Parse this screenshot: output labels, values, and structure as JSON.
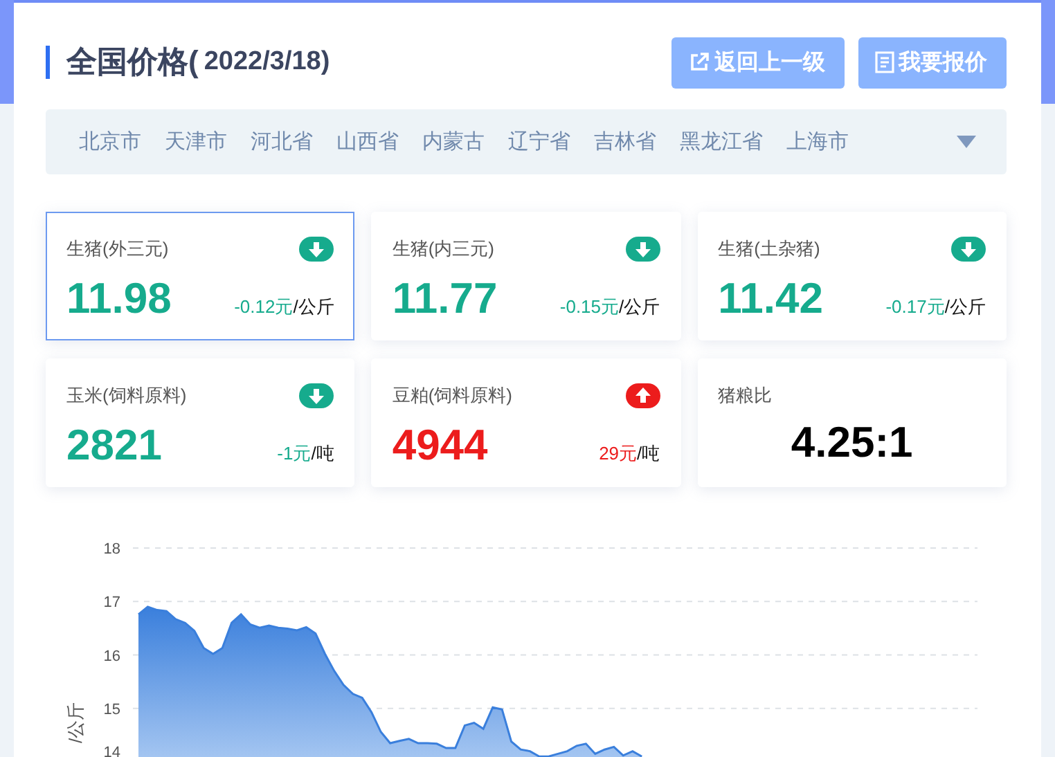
{
  "header": {
    "title": "全国价格(",
    "date": "2022/3/18)",
    "buttons": [
      {
        "kind": "back",
        "label": "返回上一级"
      },
      {
        "kind": "quote",
        "label": "我要报价"
      }
    ]
  },
  "regions": [
    "北京市",
    "天津市",
    "河北省",
    "山西省",
    "内蒙古",
    "辽宁省",
    "吉林省",
    "黑龙江省",
    "上海市"
  ],
  "cards": [
    {
      "kind": "change",
      "label": "生猪(外三元)",
      "value": "11.98",
      "change": "-0.12元",
      "unit": "/公斤",
      "rising": false,
      "selected": true
    },
    {
      "kind": "change",
      "label": "生猪(内三元)",
      "value": "11.77",
      "change": "-0.15元",
      "unit": "/公斤",
      "rising": false,
      "selected": false
    },
    {
      "kind": "change",
      "label": "生猪(土杂猪)",
      "value": "11.42",
      "change": "-0.17元",
      "unit": "/公斤",
      "rising": false,
      "selected": false
    },
    {
      "kind": "change",
      "label": "玉米(饲料原料)",
      "value": "2821",
      "change": "-1元",
      "unit": "/吨",
      "rising": false,
      "selected": false
    },
    {
      "kind": "change",
      "label": "豆粕(饲料原料)",
      "value": "4944",
      "change": "29元",
      "unit": "/吨",
      "rising": true,
      "selected": false
    },
    {
      "kind": "ratio",
      "label": "猪粮比",
      "value": "4.25:1",
      "selected": false
    }
  ],
  "chart_data": {
    "type": "area",
    "ylabel": "/公斤",
    "grid": true,
    "ylim": [
      14,
      18
    ],
    "yticks": [
      14,
      15,
      16,
      17,
      18
    ],
    "series": [
      {
        "color": "#3a7fdc",
        "values": [
          16.76,
          16.9,
          16.84,
          16.82,
          16.67,
          16.6,
          16.45,
          16.13,
          16.02,
          16.13,
          16.6,
          16.76,
          16.57,
          16.51,
          16.55,
          16.51,
          16.49,
          16.46,
          16.52,
          16.4,
          16.02,
          15.7,
          15.44,
          15.27,
          15.2,
          14.93,
          14.56,
          14.35,
          14.39,
          14.43,
          14.35,
          14.35,
          14.34,
          14.26,
          14.26,
          14.68,
          14.73,
          14.62,
          15.02,
          14.98,
          14.38,
          14.23,
          14.2,
          14.1,
          14.1,
          14.15,
          14.2,
          14.3,
          14.34,
          14.15,
          14.23,
          14.28,
          14.12,
          14.2,
          14.1,
          null,
          null,
          null,
          null,
          null,
          null,
          null,
          null,
          null,
          null,
          null,
          null,
          null,
          null,
          null,
          null,
          null,
          null,
          null,
          null,
          null,
          null,
          null,
          null,
          null,
          null,
          null,
          null,
          null,
          null,
          null,
          null,
          null,
          null,
          null,
          null
        ]
      }
    ]
  }
}
